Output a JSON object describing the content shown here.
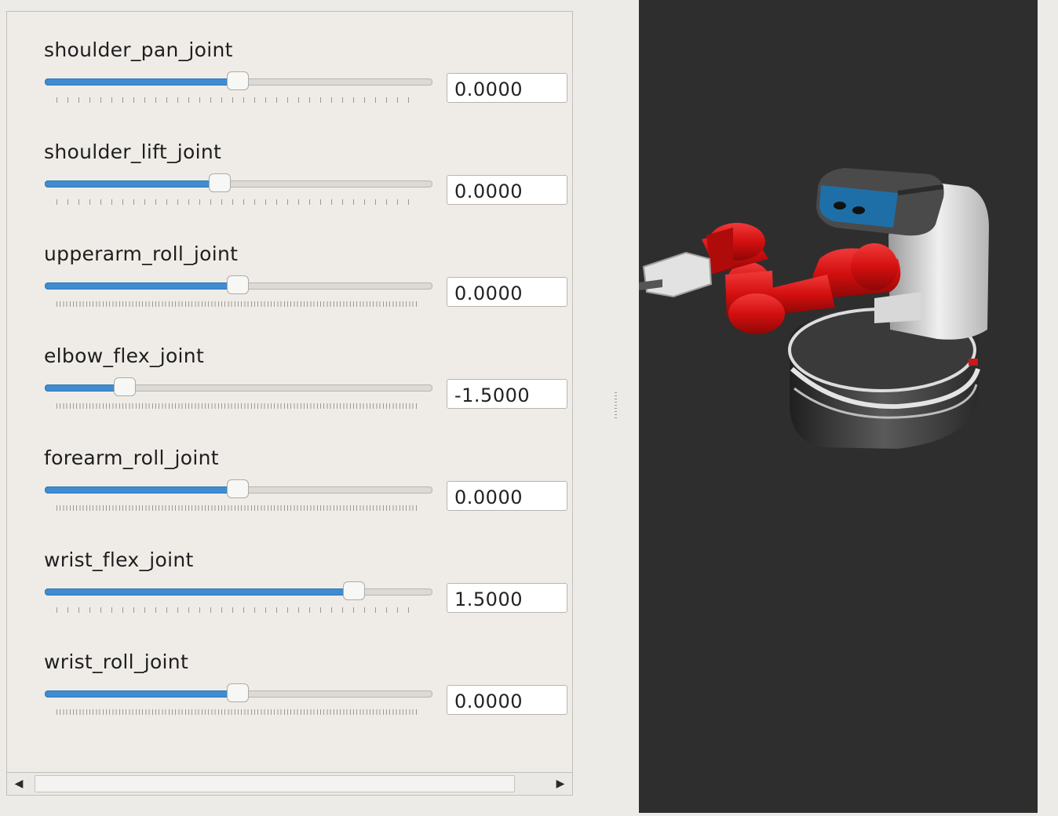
{
  "joints": [
    {
      "name": "shoulder_pan_joint",
      "value_text": "0.0000",
      "fraction": 0.5,
      "tick_style": "coarse"
    },
    {
      "name": "shoulder_lift_joint",
      "value_text": "0.0000",
      "fraction": 0.45,
      "tick_style": "coarse"
    },
    {
      "name": "upperarm_roll_joint",
      "value_text": "0.0000",
      "fraction": 0.5,
      "tick_style": "fine"
    },
    {
      "name": "elbow_flex_joint",
      "value_text": "-1.5000",
      "fraction": 0.19,
      "tick_style": "fine"
    },
    {
      "name": "forearm_roll_joint",
      "value_text": "0.0000",
      "fraction": 0.5,
      "tick_style": "fine"
    },
    {
      "name": "wrist_flex_joint",
      "value_text": "1.5000",
      "fraction": 0.82,
      "tick_style": "coarse"
    },
    {
      "name": "wrist_roll_joint",
      "value_text": "0.0000",
      "fraction": 0.5,
      "tick_style": "fine"
    }
  ],
  "icons": {
    "scroll_left": "triangle-left-icon",
    "scroll_right": "triangle-right-icon"
  },
  "colors": {
    "slider_fill": "#3f8dd0",
    "viewport_bg": "#2e2e2e",
    "robot_arm": "#d40f0f",
    "robot_head_accent": "#1e6fa8"
  }
}
